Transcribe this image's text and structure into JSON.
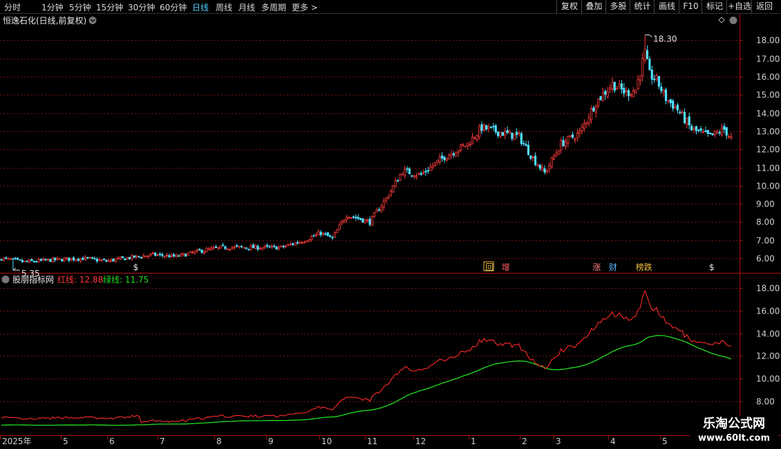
{
  "toolbar": {
    "timeframes": [
      "分时",
      "1分钟",
      "5分钟",
      "15分钟",
      "30分钟",
      "60分钟",
      "日线",
      "周线",
      "月线",
      "多周期",
      "更多 >"
    ],
    "active": "日线",
    "right_buttons": [
      "复权",
      "叠加",
      "多股",
      "统计",
      "画线",
      "F10",
      "+自选",
      "返回"
    ]
  },
  "main_title": "恒逸石化(日线,前复权)",
  "indicator_title": "股朋指标网",
  "indicator_red_label": "红线: 12.88",
  "indicator_green_label": "绿线: 11.75",
  "watermark": {
    "line1": "乐淘公式网",
    "line2": "www.60lt.com"
  },
  "colors": {
    "up": "#ff3b3b",
    "down": "#4fe0ff",
    "red_line": "#ff2a2a",
    "green_line": "#22dd22",
    "grid": "#7a1010"
  },
  "chart_data": [
    {
      "type": "candlestick",
      "title": "恒逸石化(日线,前复权)",
      "ylim": [
        5.0,
        18.7
      ],
      "yticks": [
        6.0,
        7.0,
        8.0,
        9.0,
        10.0,
        11.0,
        12.0,
        13.0,
        14.0,
        15.0,
        16.0,
        17.0,
        18.0
      ],
      "grid": true,
      "annotations": [
        {
          "label": "18.30",
          "kind": "high"
        },
        {
          "label": "5.35",
          "kind": "low"
        }
      ],
      "signals": [
        "$",
        "回",
        "增",
        "涨",
        "财",
        "榜跌",
        "$"
      ],
      "close_keypoints": [
        [
          0,
          6.0
        ],
        [
          10,
          5.8
        ],
        [
          20,
          5.9
        ],
        [
          35,
          6.0
        ],
        [
          45,
          5.85
        ],
        [
          53,
          6.0
        ],
        [
          65,
          6.2
        ],
        [
          75,
          6.1
        ],
        [
          85,
          6.4
        ],
        [
          95,
          6.6
        ],
        [
          110,
          6.6
        ],
        [
          120,
          6.6
        ],
        [
          130,
          7.0
        ],
        [
          137,
          7.4
        ],
        [
          142,
          7.1
        ],
        [
          148,
          8.4
        ],
        [
          158,
          8.0
        ],
        [
          165,
          9.3
        ],
        [
          172,
          10.8
        ],
        [
          180,
          10.6
        ],
        [
          190,
          11.6
        ],
        [
          200,
          12.3
        ],
        [
          206,
          13.2
        ],
        [
          215,
          12.9
        ],
        [
          222,
          12.7
        ],
        [
          228,
          11.5
        ],
        [
          233,
          10.7
        ],
        [
          240,
          12.3
        ],
        [
          248,
          12.9
        ],
        [
          255,
          14.6
        ],
        [
          262,
          15.6
        ],
        [
          268,
          15.1
        ],
        [
          272,
          15.3
        ],
        [
          276,
          17.3
        ],
        [
          278,
          16.1
        ],
        [
          281,
          15.8
        ],
        [
          285,
          14.8
        ],
        [
          290,
          14.2
        ],
        [
          296,
          13.1
        ],
        [
          304,
          12.7
        ],
        [
          310,
          13.1
        ],
        [
          313,
          12.6
        ]
      ]
    },
    {
      "type": "line",
      "title": "股朋指标网",
      "ylim": [
        6.8,
        18.9
      ],
      "yticks": [
        8.0,
        10.0,
        12.0,
        14.0,
        16.0,
        18.0
      ],
      "series": [
        {
          "name": "红线",
          "last": 12.88
        },
        {
          "name": "绿线",
          "last": 11.75
        }
      ]
    }
  ],
  "x_axis": {
    "labels": [
      "2025年",
      "5",
      "6",
      "7",
      "8",
      "9",
      "10",
      "11",
      "12",
      "1",
      "2",
      "3",
      "4",
      "5"
    ]
  }
}
